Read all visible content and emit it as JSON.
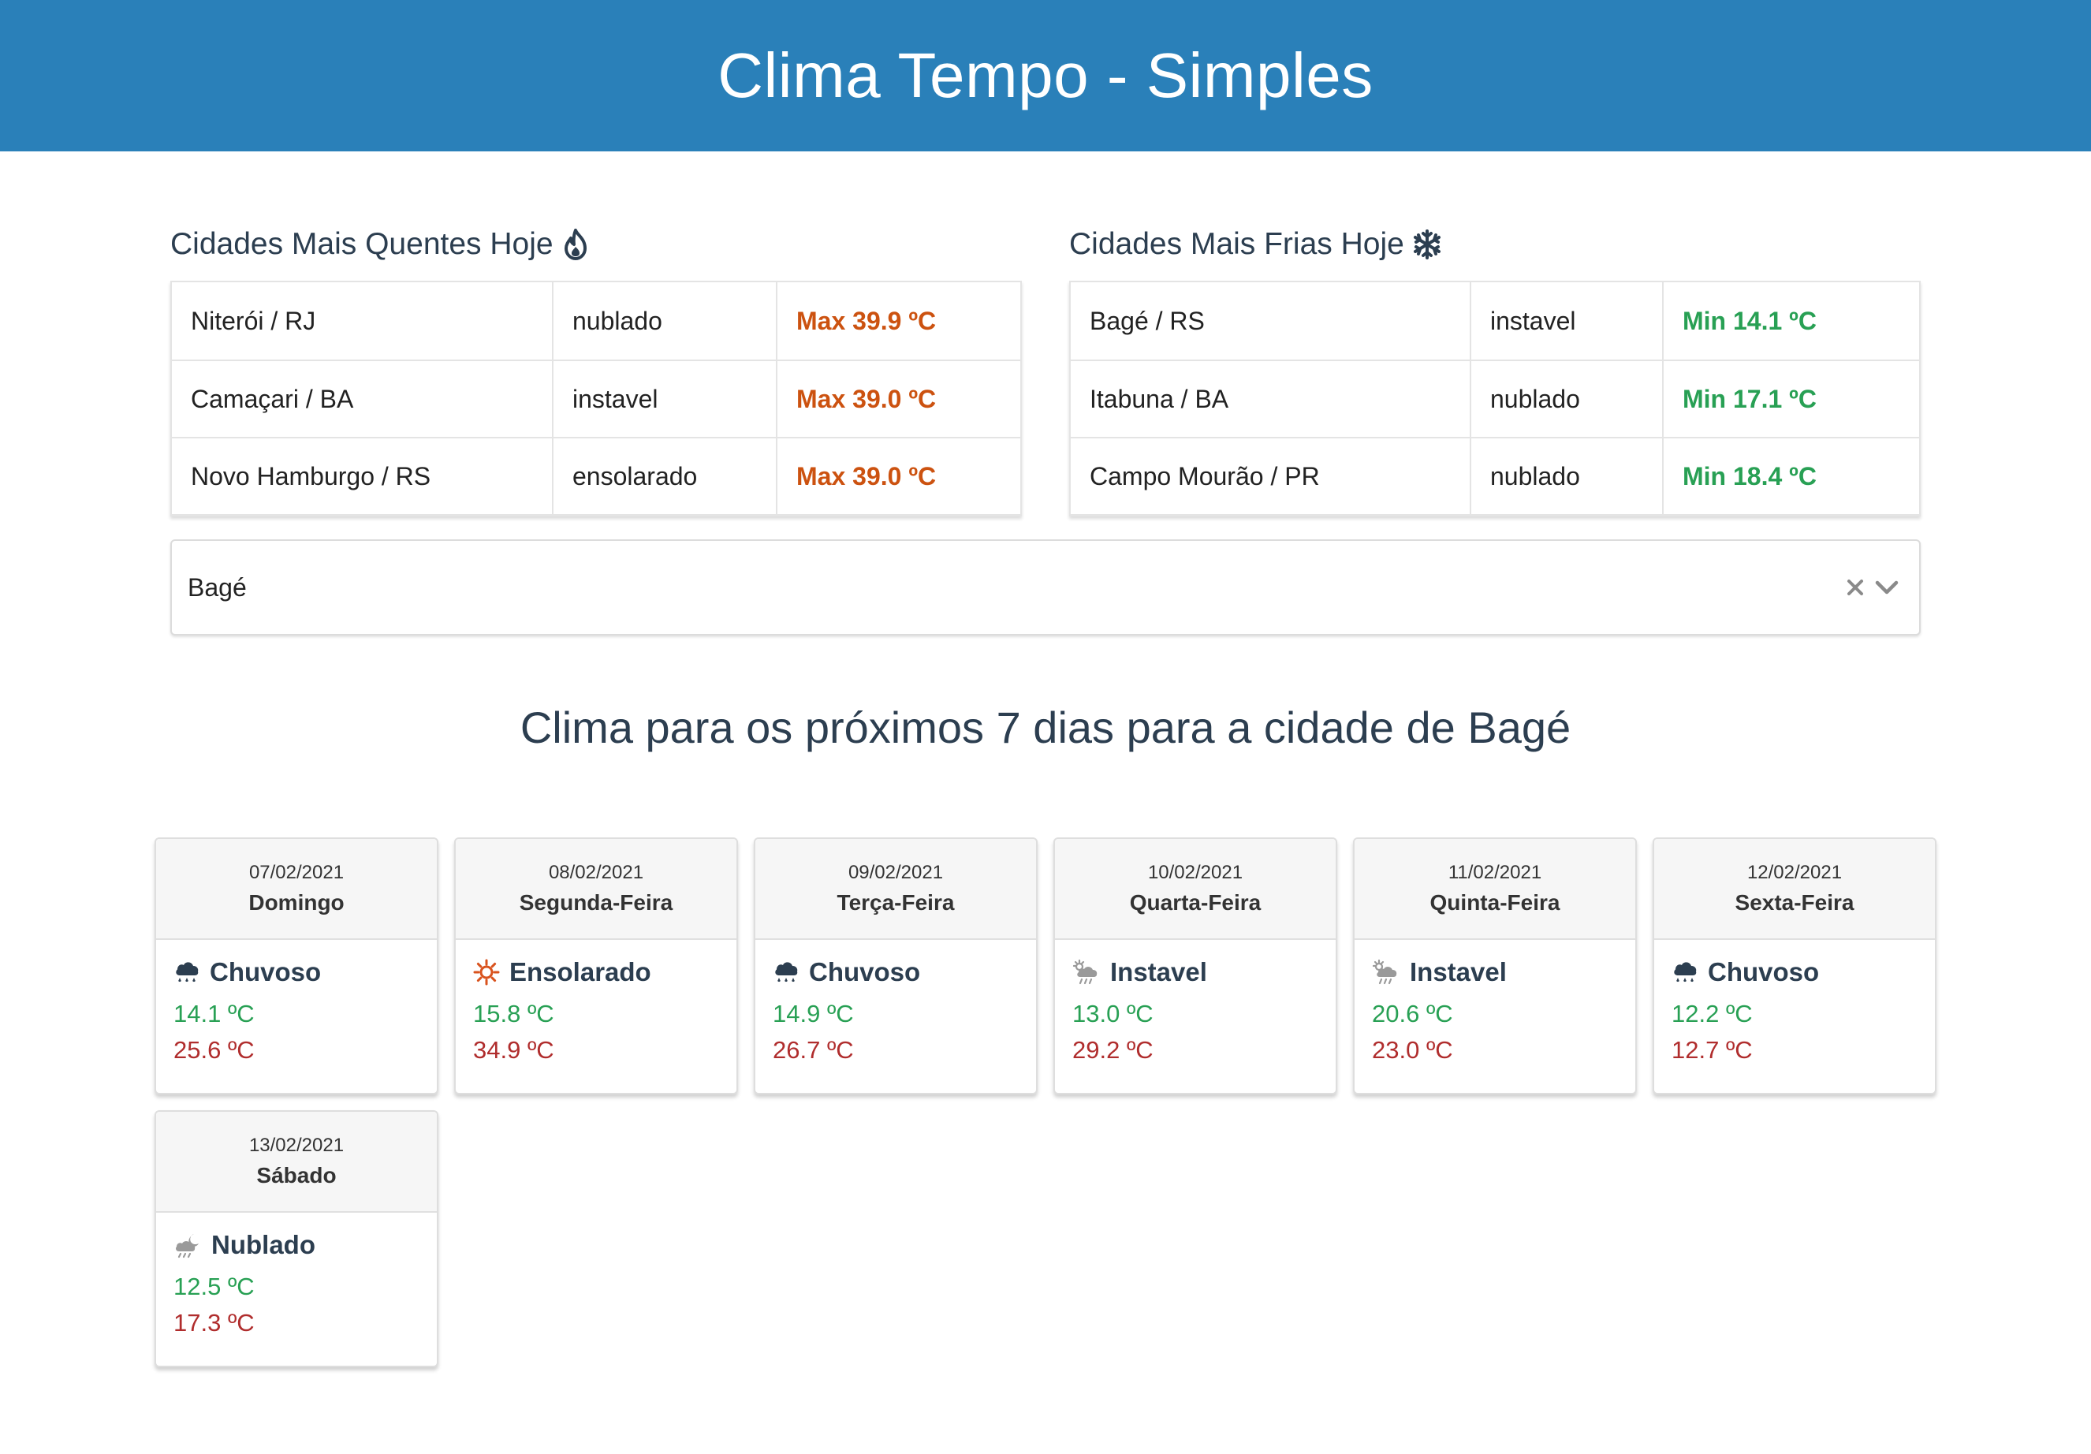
{
  "header": {
    "title": "Clima Tempo - Simples"
  },
  "hottest": {
    "title": "Cidades Mais Quentes Hoje",
    "icon": "fire-icon",
    "rows": [
      {
        "city": "Niterói / RJ",
        "condition": "nublado",
        "temp": "Max 39.9 ºC"
      },
      {
        "city": "Camaçari / BA",
        "condition": "instavel",
        "temp": "Max 39.0 ºC"
      },
      {
        "city": "Novo Hamburgo / RS",
        "condition": "ensolarado",
        "temp": "Max 39.0 ºC"
      }
    ]
  },
  "coldest": {
    "title": "Cidades Mais Frias Hoje",
    "icon": "snowflake-icon",
    "rows": [
      {
        "city": "Bagé / RS",
        "condition": "instavel",
        "temp": "Min 14.1 ºC"
      },
      {
        "city": "Itabuna / BA",
        "condition": "nublado",
        "temp": "Min 17.1 ºC"
      },
      {
        "city": "Campo Mourão / PR",
        "condition": "nublado",
        "temp": "Min 18.4 ºC"
      }
    ]
  },
  "city_select": {
    "value": "Bagé",
    "clear_icon": "close-icon",
    "toggle_icon": "chevron-down-icon"
  },
  "forecast": {
    "title": "Clima para os próximos 7 dias para a cidade de Bagé",
    "days": [
      {
        "date": "07/02/2021",
        "weekday": "Domingo",
        "condition": "Chuvoso",
        "icon": "rain-cloud-icon",
        "min": "14.1 ºC",
        "max": "25.6 ºC"
      },
      {
        "date": "08/02/2021",
        "weekday": "Segunda-Feira",
        "condition": "Ensolarado",
        "icon": "sun-icon",
        "min": "15.8 ºC",
        "max": "34.9 ºC"
      },
      {
        "date": "09/02/2021",
        "weekday": "Terça-Feira",
        "condition": "Chuvoso",
        "icon": "rain-cloud-icon",
        "min": "14.9 ºC",
        "max": "26.7 ºC"
      },
      {
        "date": "10/02/2021",
        "weekday": "Quarta-Feira",
        "condition": "Instavel",
        "icon": "sun-rain-cloud-icon",
        "min": "13.0 ºC",
        "max": "29.2 ºC"
      },
      {
        "date": "11/02/2021",
        "weekday": "Quinta-Feira",
        "condition": "Instavel",
        "icon": "sun-rain-cloud-icon",
        "min": "20.6 ºC",
        "max": "23.0 ºC"
      },
      {
        "date": "12/02/2021",
        "weekday": "Sexta-Feira",
        "condition": "Chuvoso",
        "icon": "rain-cloud-icon",
        "min": "12.2 ºC",
        "max": "12.7 ºC"
      },
      {
        "date": "13/02/2021",
        "weekday": "Sábado",
        "condition": "Nublado",
        "icon": "moon-rain-cloud-icon",
        "min": "12.5 ºC",
        "max": "17.3 ºC"
      }
    ]
  }
}
